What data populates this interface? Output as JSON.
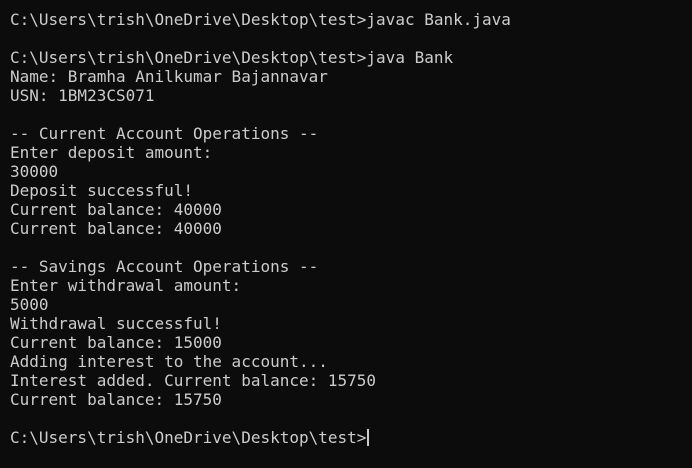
{
  "terminal": {
    "lines": [
      "C:\\Users\\trish\\OneDrive\\Desktop\\test>javac Bank.java",
      "",
      "C:\\Users\\trish\\OneDrive\\Desktop\\test>java Bank",
      "Name: Bramha Anilkumar Bajannavar",
      "USN: 1BM23CS071",
      "",
      "-- Current Account Operations --",
      "Enter deposit amount:",
      "30000",
      "Deposit successful!",
      "Current balance: 40000",
      "Current balance: 40000",
      "",
      "-- Savings Account Operations --",
      "Enter withdrawal amount:",
      "5000",
      "Withdrawal successful!",
      "Current balance: 15000",
      "Adding interest to the account...",
      "Interest added. Current balance: 15750",
      "Current balance: 15750",
      ""
    ],
    "prompt": "C:\\Users\\trish\\OneDrive\\Desktop\\test>"
  },
  "colors": {
    "background": "#0c0c0c",
    "foreground": "#cccccc"
  }
}
